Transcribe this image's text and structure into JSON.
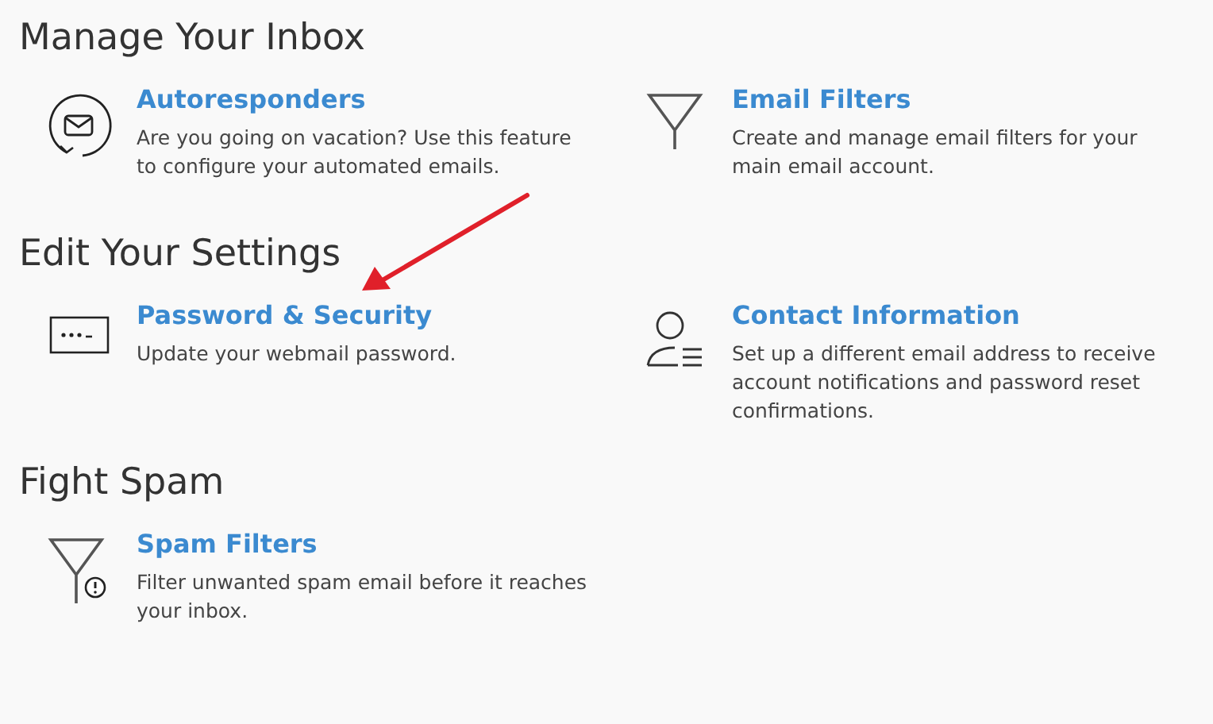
{
  "sections": [
    {
      "title": "Manage Your Inbox",
      "items": [
        {
          "kind": "autoresponder",
          "title": "Autoresponders",
          "description": "Are you going on vacation? Use this feature to configure your automated emails."
        },
        {
          "kind": "filter",
          "title": "Email Filters",
          "description": "Create and manage email filters for your main email account."
        }
      ]
    },
    {
      "title": "Edit Your Settings",
      "items": [
        {
          "kind": "password",
          "title": "Password & Security",
          "description": "Update your webmail password."
        },
        {
          "kind": "contact",
          "title": "Contact Information",
          "description": "Set up a different email address to receive account notifications and password reset confirmations."
        }
      ]
    },
    {
      "title": "Fight Spam",
      "items": [
        {
          "kind": "spam",
          "title": "Spam Filters",
          "description": "Filter unwanted spam email before it reaches your inbox."
        }
      ]
    }
  ]
}
